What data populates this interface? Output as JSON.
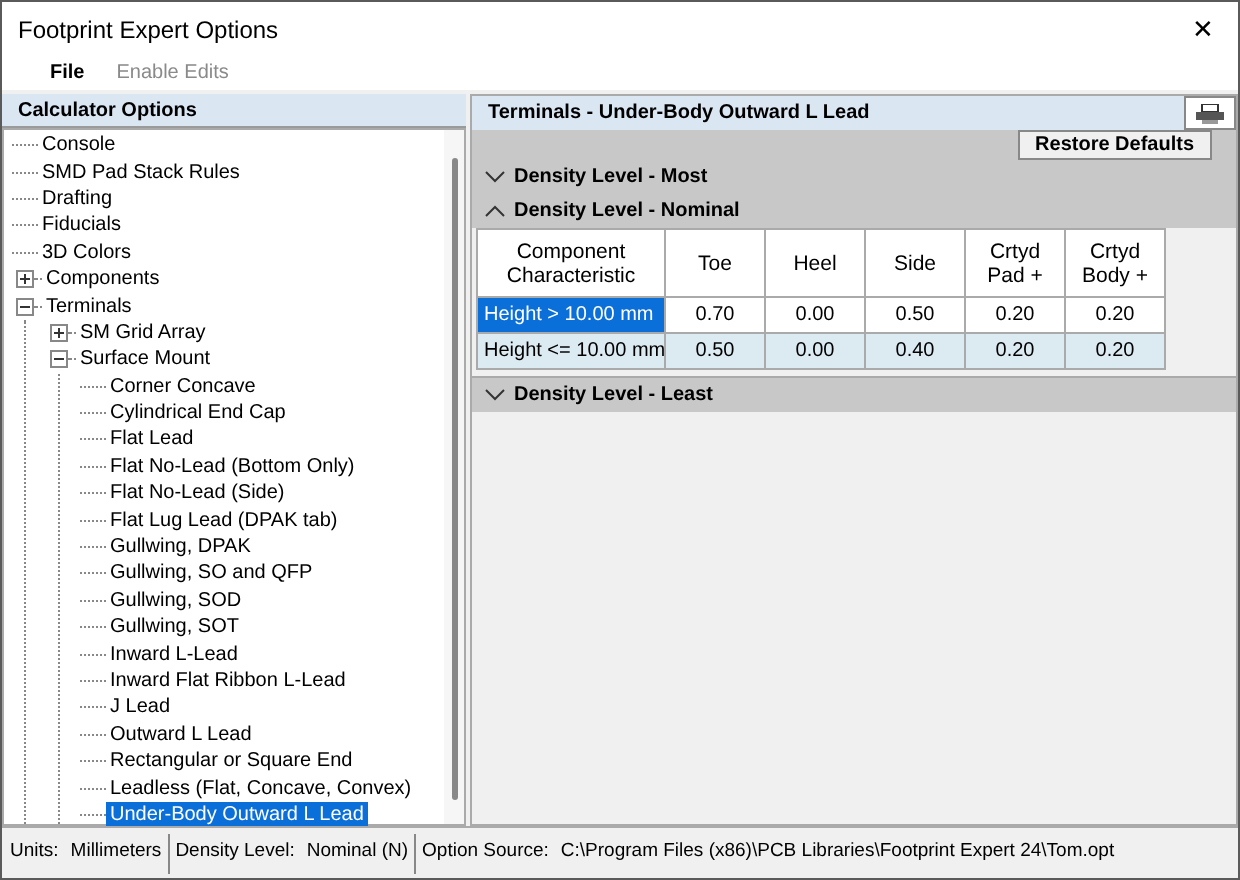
{
  "window": {
    "title": "Footprint Expert Options",
    "close": "✕"
  },
  "menu": [
    {
      "label": "File",
      "disabled": false
    },
    {
      "label": "Enable Edits",
      "disabled": true
    }
  ],
  "sidebar": {
    "title": "Calculator Options",
    "tree": [
      {
        "label": "Console",
        "selected": false
      },
      {
        "label": "SMD Pad Stack Rules",
        "selected": false
      },
      {
        "label": "Drafting",
        "selected": false
      },
      {
        "label": "Fiducials",
        "selected": false
      },
      {
        "label": "3D Colors",
        "selected": false
      },
      {
        "label": "Components",
        "selected": false,
        "expanded": false
      },
      {
        "label": "Terminals",
        "selected": false,
        "expanded": true,
        "children": [
          {
            "label": "SM Grid Array",
            "selected": false,
            "expanded": false
          },
          {
            "label": "Surface Mount",
            "selected": false,
            "expanded": true,
            "children": [
              {
                "label": "Corner Concave",
                "selected": false
              },
              {
                "label": "Cylindrical End Cap",
                "selected": false
              },
              {
                "label": "Flat Lead",
                "selected": false
              },
              {
                "label": "Flat No-Lead (Bottom Only)",
                "selected": false
              },
              {
                "label": "Flat No-Lead (Side)",
                "selected": false
              },
              {
                "label": "Flat Lug Lead (DPAK tab)",
                "selected": false
              },
              {
                "label": "Gullwing, DPAK",
                "selected": false
              },
              {
                "label": "Gullwing, SO and QFP",
                "selected": false
              },
              {
                "label": "Gullwing, SOD",
                "selected": false
              },
              {
                "label": "Gullwing, SOT",
                "selected": false
              },
              {
                "label": "Inward L-Lead",
                "selected": false
              },
              {
                "label": "Inward Flat Ribbon L-Lead",
                "selected": false
              },
              {
                "label": "J Lead",
                "selected": false
              },
              {
                "label": "Outward L Lead",
                "selected": false
              },
              {
                "label": "Rectangular or Square End",
                "selected": false
              },
              {
                "label": "Leadless (Flat, Concave, Convex)",
                "selected": false
              },
              {
                "label": "Under-Body Outward L Lead",
                "selected": true
              }
            ]
          }
        ]
      }
    ]
  },
  "panel": {
    "title": "Terminals - Under-Body Outward L Lead",
    "restore_button": "Restore Defaults",
    "sections": [
      {
        "label": "Density Level - Most",
        "expanded": false
      },
      {
        "label": "Density Level - Nominal",
        "expanded": true,
        "table": {
          "columns": [
            "Component Characteristic",
            "Toe",
            "Heel",
            "Side",
            "Crtyd Pad +",
            "Crtyd Body +"
          ],
          "rows": [
            {
              "selected": true,
              "cells": [
                "Height > 10.00 mm",
                "0.70",
                "0.00",
                "0.50",
                "0.20",
                "0.20"
              ]
            },
            {
              "selected": false,
              "cells": [
                "Height <= 10.00 mm",
                "0.50",
                "0.00",
                "0.40",
                "0.20",
                "0.20"
              ]
            }
          ]
        }
      },
      {
        "label": "Density Level - Least",
        "expanded": false
      }
    ]
  },
  "status_bar": [
    {
      "label": "Units:",
      "value": "Millimeters"
    },
    {
      "label": "Density Level:",
      "value": "Nominal (N)"
    },
    {
      "label": "Option Source:",
      "value": "C:\\Program Files (x86)\\PCB Libraries\\Footprint Expert 24\\Tom.opt"
    }
  ]
}
